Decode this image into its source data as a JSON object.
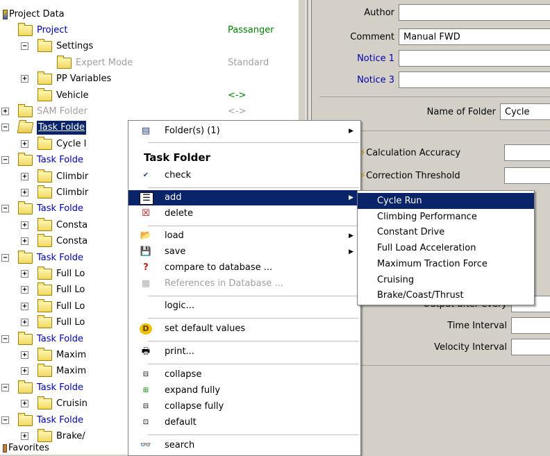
{
  "tree": {
    "root_label": "Project Data",
    "favorites_label": "Favorites",
    "rows": [
      {
        "label": "Project",
        "value": "Passanger",
        "label_color": "blue",
        "value_color": "green"
      },
      {
        "label": "Settings",
        "value": ""
      },
      {
        "label": "Expert Mode",
        "value": "Standard",
        "label_color": "gray",
        "value_color": "gray"
      },
      {
        "label": "PP Variables",
        "value": ""
      },
      {
        "label": "Vehicle",
        "value": "<->",
        "value_color": "green"
      },
      {
        "label": "SAM Folder",
        "value": "<->",
        "label_color": "gray",
        "value_color": "gray"
      },
      {
        "label": "Task Folde",
        "value": "",
        "selected": true
      },
      {
        "label": "Cycle I",
        "value": ""
      },
      {
        "label": "Task Folde",
        "value": "",
        "label_color": "blue"
      },
      {
        "label": "Climbir",
        "value": ""
      },
      {
        "label": "Climbir",
        "value": ""
      },
      {
        "label": "Task Folde",
        "value": "",
        "label_color": "blue"
      },
      {
        "label": "Consta",
        "value": ""
      },
      {
        "label": "Consta",
        "value": ""
      },
      {
        "label": "Task Folde",
        "value": "",
        "label_color": "blue"
      },
      {
        "label": "Full Lo",
        "value": ""
      },
      {
        "label": "Full Lo",
        "value": ""
      },
      {
        "label": "Full Lo",
        "value": ""
      },
      {
        "label": "Full Lo",
        "value": ""
      },
      {
        "label": "Task Folde",
        "value": "",
        "label_color": "blue"
      },
      {
        "label": "Maxim",
        "value": ""
      },
      {
        "label": "Maxim",
        "value": ""
      },
      {
        "label": "Task Folde",
        "value": "",
        "label_color": "blue"
      },
      {
        "label": "Cruisin",
        "value": ""
      },
      {
        "label": "Task Folde",
        "value": "",
        "label_color": "blue"
      },
      {
        "label": "Brake/",
        "value": ""
      }
    ]
  },
  "props": {
    "author_label": "Author",
    "author_value": "",
    "comment_label": "Comment",
    "comment_value": "Manual FWD",
    "notice1_label": "Notice 1",
    "notice3_label": "Notice 3",
    "folder_name_label": "Name of Folder",
    "folder_name_value": "Cycle",
    "calc_accuracy_label": "Calculation Accuracy",
    "correction_threshold_label": "Correction Threshold",
    "output_after_label": "Output after every",
    "time_interval_label": "Time Interval",
    "velocity_interval_label": "Velocity Interval"
  },
  "context_menu": {
    "folders_label": "Folder(s) (1)",
    "header": "Task Folder",
    "check": "check",
    "add": "add",
    "delete": "delete",
    "load": "load",
    "save": "save",
    "compare": "compare to database ...",
    "references": "References in Database ...",
    "logic": "logic...",
    "set_default": "set default values",
    "print": "print...",
    "collapse": "collapse",
    "expand_fully": "expand fully",
    "collapse_fully": "collapse fully",
    "default": "default",
    "search": "search"
  },
  "submenu": {
    "items": [
      "Cycle Run",
      "Climbing Performance",
      "Constant Drive",
      "Full Load Acceleration",
      "Maximum Traction Force",
      "Cruising",
      "Brake/Coast/Thrust"
    ]
  },
  "colors": {
    "selection": "#0a246a",
    "link_blue": "#0000b0",
    "value_green": "#008000",
    "panel": "#d4d0c8"
  }
}
